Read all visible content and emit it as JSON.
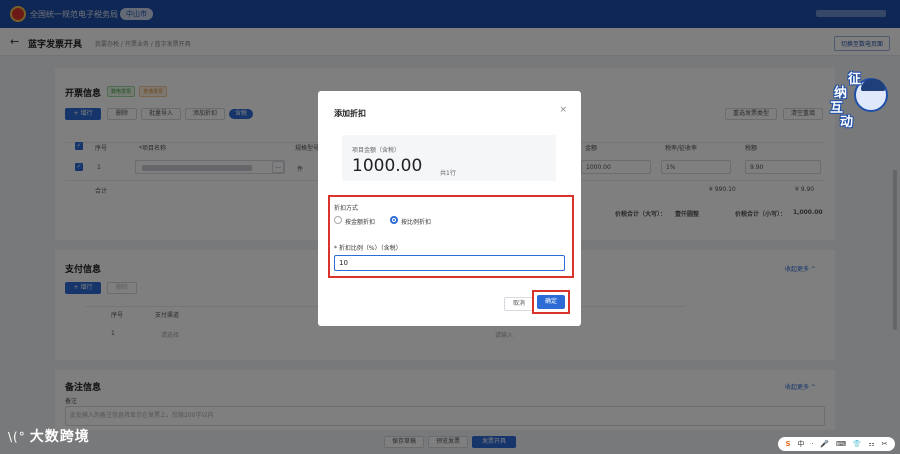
{
  "app": {
    "title": "全国统一规范电子税务局",
    "location_tag": "中山市"
  },
  "header": {
    "back_icon": "←",
    "page_title": "蓝字发票开具",
    "breadcrumb": "我要办税 / 开票业务 / 蓝字发票开具",
    "switch_label": "切换至数电页面"
  },
  "invoice_info": {
    "title": "开票信息",
    "tags": [
      "数电发票",
      "普通发票"
    ],
    "buttons": {
      "add_row": "+ 增行",
      "delete": "删除",
      "batch_import": "批量导入",
      "add_discount": "添加折扣",
      "toggle": "含税"
    },
    "right_buttons": {
      "reselect_type": "重选发票类型",
      "clear": "清空重填"
    },
    "row_index": "1",
    "headers": {
      "seq": "序号",
      "item": "*项目名称",
      "spec": "规格型号",
      "amount": "金额",
      "rate": "税率/征收率",
      "tax": "税额"
    },
    "row": {
      "unit": "件",
      "amount": "1000.00",
      "rate": "1%",
      "tax": "9.90"
    },
    "sum_label": "合计",
    "sum_amount": "¥ 990.10",
    "sum_tax": "¥ 9.90",
    "total_upper_label": "价税合计（大写）：",
    "total_upper_value": "壹仟圆整",
    "total_lower_label": "价税合计（小写）：",
    "total_lower_value": "1,000.00"
  },
  "payment_info": {
    "title": "支付信息",
    "collapse": "收起更多 ^",
    "add_row": "+ 增行",
    "delete": "删除",
    "headers": {
      "seq": "序号",
      "channel": "支付渠道"
    },
    "row_index": "1",
    "channel_placeholder": "请选择",
    "amount_placeholder": "请输入"
  },
  "remarks": {
    "title": "备注信息",
    "collapse": "收起更多 ^",
    "label": "备注",
    "placeholder": "此处输入的备注信息将显示在发票上，仅限200字以内"
  },
  "footer": {
    "save_draft": "保存草稿",
    "preview": "预览发票",
    "issue": "发票开具"
  },
  "modal": {
    "title": "添加折扣",
    "close_icon": "×",
    "amount_label": "项目金额（含税）",
    "amount_value": "1000.00",
    "rows_count": "共1行",
    "discount_method_label": "折扣方式",
    "option_amount": "按金额折扣",
    "option_ratio": "按比例折扣",
    "selected_option": "按比例折扣",
    "ratio_label": "* 折扣比例（%）（含税）",
    "ratio_value": "10",
    "cancel": "取消",
    "confirm": "确定"
  },
  "mascot": {
    "chars": [
      "征",
      "纳",
      "互",
      "动"
    ]
  },
  "watermark": {
    "logo": "\\(°",
    "text": "大数跨境"
  },
  "tray": {
    "items": [
      "S",
      "中",
      "·",
      "🎤",
      "⌨",
      "👕",
      "⚏",
      "✂"
    ]
  },
  "colors": {
    "primary": "#2d6bd6",
    "header_bg": "#1f4fa8",
    "highlight": "#d9342b"
  }
}
